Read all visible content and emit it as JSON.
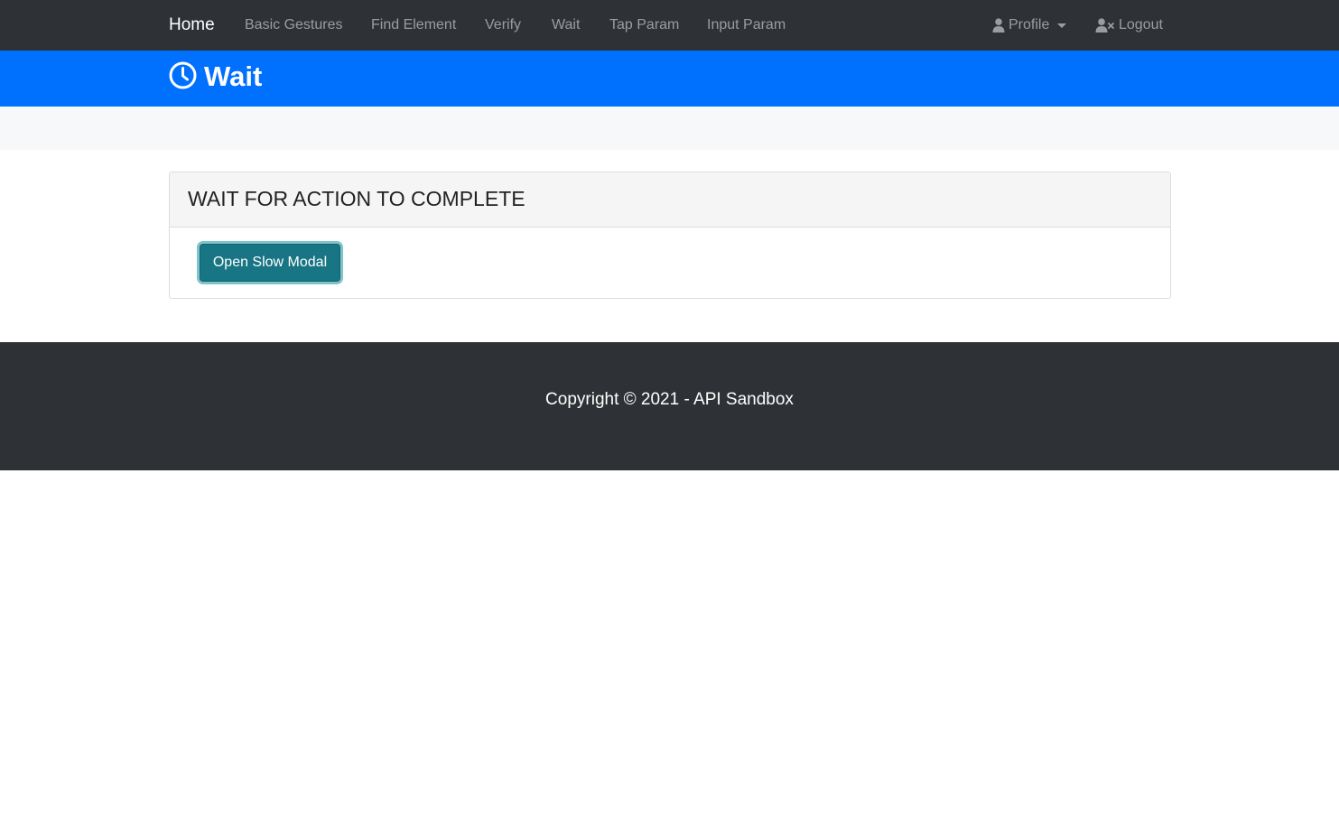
{
  "navbar": {
    "brand": "Home",
    "links": [
      "Basic Gestures",
      "Find Element",
      "Verify",
      "Wait",
      "Tap Param",
      "Input Param"
    ],
    "profile_label": "Profile",
    "logout_label": "Logout",
    "background_color": "#2e3236",
    "icons": {
      "profile": "user-icon",
      "logout": "user-times-icon"
    }
  },
  "page_header": {
    "title": "Wait",
    "icon": "clock-icon",
    "background_color": "#0070fe"
  },
  "card": {
    "title": "WAIT FOR ACTION TO COMPLETE",
    "button_label": "Open Slow Modal",
    "button_color": "#187583"
  },
  "footer": {
    "text": "Copyright © 2021 - API Sandbox"
  }
}
